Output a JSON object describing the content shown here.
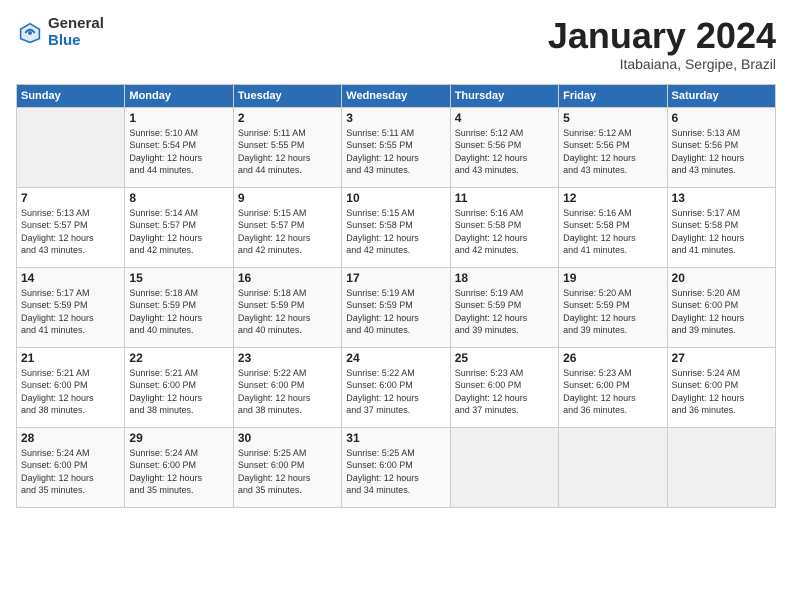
{
  "header": {
    "logo_general": "General",
    "logo_blue": "Blue",
    "month_title": "January 2024",
    "subtitle": "Itabaiana, Sergipe, Brazil"
  },
  "days_of_week": [
    "Sunday",
    "Monday",
    "Tuesday",
    "Wednesday",
    "Thursday",
    "Friday",
    "Saturday"
  ],
  "weeks": [
    [
      {
        "day": "",
        "info": ""
      },
      {
        "day": "1",
        "info": "Sunrise: 5:10 AM\nSunset: 5:54 PM\nDaylight: 12 hours\nand 44 minutes."
      },
      {
        "day": "2",
        "info": "Sunrise: 5:11 AM\nSunset: 5:55 PM\nDaylight: 12 hours\nand 44 minutes."
      },
      {
        "day": "3",
        "info": "Sunrise: 5:11 AM\nSunset: 5:55 PM\nDaylight: 12 hours\nand 43 minutes."
      },
      {
        "day": "4",
        "info": "Sunrise: 5:12 AM\nSunset: 5:56 PM\nDaylight: 12 hours\nand 43 minutes."
      },
      {
        "day": "5",
        "info": "Sunrise: 5:12 AM\nSunset: 5:56 PM\nDaylight: 12 hours\nand 43 minutes."
      },
      {
        "day": "6",
        "info": "Sunrise: 5:13 AM\nSunset: 5:56 PM\nDaylight: 12 hours\nand 43 minutes."
      }
    ],
    [
      {
        "day": "7",
        "info": "Sunrise: 5:13 AM\nSunset: 5:57 PM\nDaylight: 12 hours\nand 43 minutes."
      },
      {
        "day": "8",
        "info": "Sunrise: 5:14 AM\nSunset: 5:57 PM\nDaylight: 12 hours\nand 42 minutes."
      },
      {
        "day": "9",
        "info": "Sunrise: 5:15 AM\nSunset: 5:57 PM\nDaylight: 12 hours\nand 42 minutes."
      },
      {
        "day": "10",
        "info": "Sunrise: 5:15 AM\nSunset: 5:58 PM\nDaylight: 12 hours\nand 42 minutes."
      },
      {
        "day": "11",
        "info": "Sunrise: 5:16 AM\nSunset: 5:58 PM\nDaylight: 12 hours\nand 42 minutes."
      },
      {
        "day": "12",
        "info": "Sunrise: 5:16 AM\nSunset: 5:58 PM\nDaylight: 12 hours\nand 41 minutes."
      },
      {
        "day": "13",
        "info": "Sunrise: 5:17 AM\nSunset: 5:58 PM\nDaylight: 12 hours\nand 41 minutes."
      }
    ],
    [
      {
        "day": "14",
        "info": "Sunrise: 5:17 AM\nSunset: 5:59 PM\nDaylight: 12 hours\nand 41 minutes."
      },
      {
        "day": "15",
        "info": "Sunrise: 5:18 AM\nSunset: 5:59 PM\nDaylight: 12 hours\nand 40 minutes."
      },
      {
        "day": "16",
        "info": "Sunrise: 5:18 AM\nSunset: 5:59 PM\nDaylight: 12 hours\nand 40 minutes."
      },
      {
        "day": "17",
        "info": "Sunrise: 5:19 AM\nSunset: 5:59 PM\nDaylight: 12 hours\nand 40 minutes."
      },
      {
        "day": "18",
        "info": "Sunrise: 5:19 AM\nSunset: 5:59 PM\nDaylight: 12 hours\nand 39 minutes."
      },
      {
        "day": "19",
        "info": "Sunrise: 5:20 AM\nSunset: 5:59 PM\nDaylight: 12 hours\nand 39 minutes."
      },
      {
        "day": "20",
        "info": "Sunrise: 5:20 AM\nSunset: 6:00 PM\nDaylight: 12 hours\nand 39 minutes."
      }
    ],
    [
      {
        "day": "21",
        "info": "Sunrise: 5:21 AM\nSunset: 6:00 PM\nDaylight: 12 hours\nand 38 minutes."
      },
      {
        "day": "22",
        "info": "Sunrise: 5:21 AM\nSunset: 6:00 PM\nDaylight: 12 hours\nand 38 minutes."
      },
      {
        "day": "23",
        "info": "Sunrise: 5:22 AM\nSunset: 6:00 PM\nDaylight: 12 hours\nand 38 minutes."
      },
      {
        "day": "24",
        "info": "Sunrise: 5:22 AM\nSunset: 6:00 PM\nDaylight: 12 hours\nand 37 minutes."
      },
      {
        "day": "25",
        "info": "Sunrise: 5:23 AM\nSunset: 6:00 PM\nDaylight: 12 hours\nand 37 minutes."
      },
      {
        "day": "26",
        "info": "Sunrise: 5:23 AM\nSunset: 6:00 PM\nDaylight: 12 hours\nand 36 minutes."
      },
      {
        "day": "27",
        "info": "Sunrise: 5:24 AM\nSunset: 6:00 PM\nDaylight: 12 hours\nand 36 minutes."
      }
    ],
    [
      {
        "day": "28",
        "info": "Sunrise: 5:24 AM\nSunset: 6:00 PM\nDaylight: 12 hours\nand 35 minutes."
      },
      {
        "day": "29",
        "info": "Sunrise: 5:24 AM\nSunset: 6:00 PM\nDaylight: 12 hours\nand 35 minutes."
      },
      {
        "day": "30",
        "info": "Sunrise: 5:25 AM\nSunset: 6:00 PM\nDaylight: 12 hours\nand 35 minutes."
      },
      {
        "day": "31",
        "info": "Sunrise: 5:25 AM\nSunset: 6:00 PM\nDaylight: 12 hours\nand 34 minutes."
      },
      {
        "day": "",
        "info": ""
      },
      {
        "day": "",
        "info": ""
      },
      {
        "day": "",
        "info": ""
      }
    ]
  ]
}
